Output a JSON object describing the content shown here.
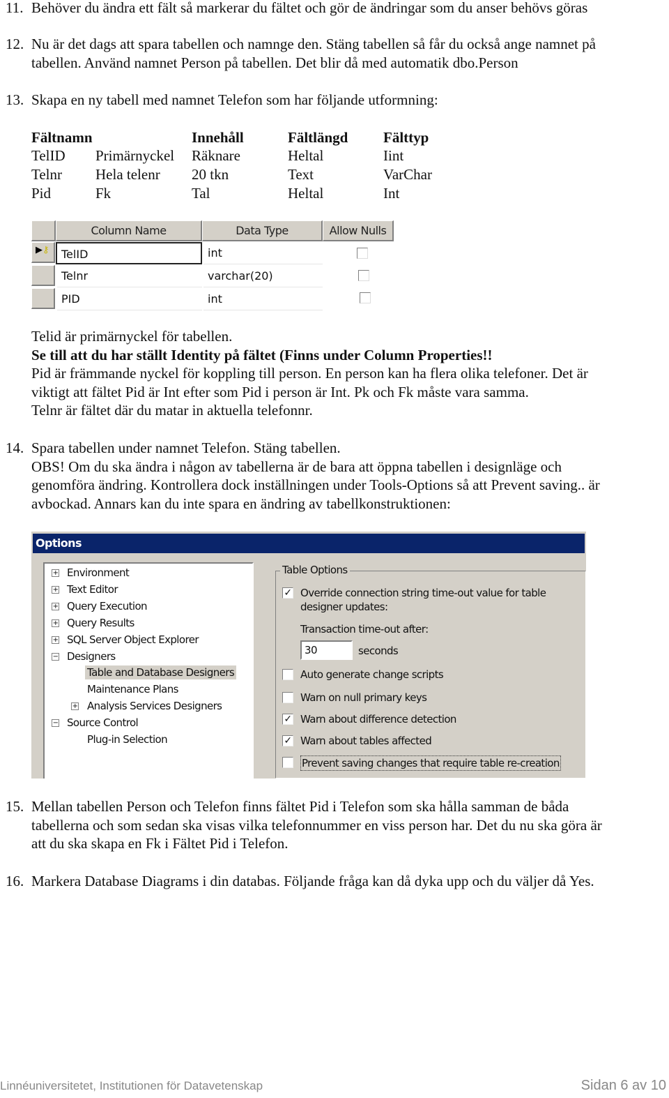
{
  "items": {
    "i11": {
      "num": "11.",
      "lines": [
        "Behöver du ändra ett fält så markerar du fältet och gör de ändringar som du anser behövs göras"
      ]
    },
    "i12": {
      "num": "12.",
      "lines": [
        "Nu är det dags att spara tabellen och namnge den. Stäng tabellen så får du också ange namnet på",
        "tabellen. Använd namnet Person på tabellen. Det blir då med automatik dbo.Person"
      ]
    },
    "i13": {
      "num": "13.",
      "lines": [
        "Skapa en ny tabell med namnet Telefon som har följande utformning:"
      ]
    },
    "i14": {
      "num": "14.",
      "lines": [
        "Spara tabellen under namnet Telefon. Stäng tabellen.",
        "OBS! Om du ska ändra i någon av tabellerna är de bara att öppna tabellen i designläge och",
        "genomföra ändring. Kontrollera dock inställningen under Tools-Options så att Prevent saving.. är",
        "avbockad. Annars kan du inte spara en ändring av tabellkonstruktionen:"
      ]
    },
    "i15": {
      "num": "15.",
      "lines": [
        "Mellan tabellen Person och Telefon finns fältet Pid i Telefon som ska hålla samman de båda",
        "tabellerna och som sedan ska visas vilka telefonnummer en viss person har. Det du nu ska göra är",
        "att du ska skapa en Fk i Fältet Pid i Telefon."
      ]
    },
    "i16": {
      "num": "16.",
      "lines": [
        "Markera Database Diagrams i din databas. Följande fråga kan då dyka upp och du väljer då Yes."
      ]
    }
  },
  "field_table": {
    "headers": [
      "Fältnamn",
      "",
      "Innehåll",
      "Fältlängd",
      "Fälttyp"
    ],
    "rows": [
      [
        "TelID",
        "Primärnyckel",
        "Räknare",
        "Heltal",
        "Iint"
      ],
      [
        "Telnr",
        "Hela telenr",
        "20 tkn",
        "Text",
        "VarChar"
      ],
      [
        "Pid",
        "Fk",
        "Tal",
        "Heltal",
        "Int"
      ]
    ]
  },
  "designer_grid": {
    "headers": [
      "Column Name",
      "Data Type",
      "Allow Nulls"
    ],
    "rows": [
      {
        "name": "TelID",
        "type": "int",
        "allow_nulls": false,
        "primary_key": true
      },
      {
        "name": "Telnr",
        "type": "varchar(20)",
        "allow_nulls": false
      },
      {
        "name": "PID",
        "type": "int",
        "allow_nulls": false
      }
    ]
  },
  "notes": {
    "l1": "Telid är primärnyckel för tabellen.",
    "l2": "Se till att du har ställt Identity på fältet (Finns under Column Properties!!",
    "l3": "Pid är främmande nyckel för koppling till person. En person kan ha flera olika telefoner. Det är",
    "l4": "viktigt att fältet Pid är Int efter som Pid i person är Int. Pk och Fk måste vara samma.",
    "l5": "Telnr är fältet där du matar in aktuella telefonnr."
  },
  "options_dialog": {
    "title": "Options",
    "title_color": "#0a246a",
    "tree": [
      "Environment",
      "Text Editor",
      "Query Execution",
      "Query Results",
      "SQL Server Object Explorer",
      "Designers",
      "Table and Database Designers",
      "Maintenance Plans",
      "Analysis Services Designers",
      "Source Control",
      "Plug-in Selection"
    ],
    "group_label": "Table Options",
    "override_label": [
      "Override connection string time-out value for table",
      "designer updates:"
    ],
    "override_checked": true,
    "timeout_label": "Transaction time-out after:",
    "timeout_value": "30",
    "timeout_unit": "seconds",
    "checks": [
      {
        "label": "Auto generate change scripts",
        "checked": false
      },
      {
        "label": "Warn on null primary keys",
        "checked": false
      },
      {
        "label": "Warn about difference detection",
        "checked": true
      },
      {
        "label": "Warn about tables affected",
        "checked": true
      },
      {
        "label": "Prevent saving changes that require table re-creation",
        "checked": false
      }
    ]
  },
  "footer": {
    "left": "Linnéuniversitetet, Institutionen för Datavetenskap",
    "right": "Sidan 6 av 10"
  }
}
